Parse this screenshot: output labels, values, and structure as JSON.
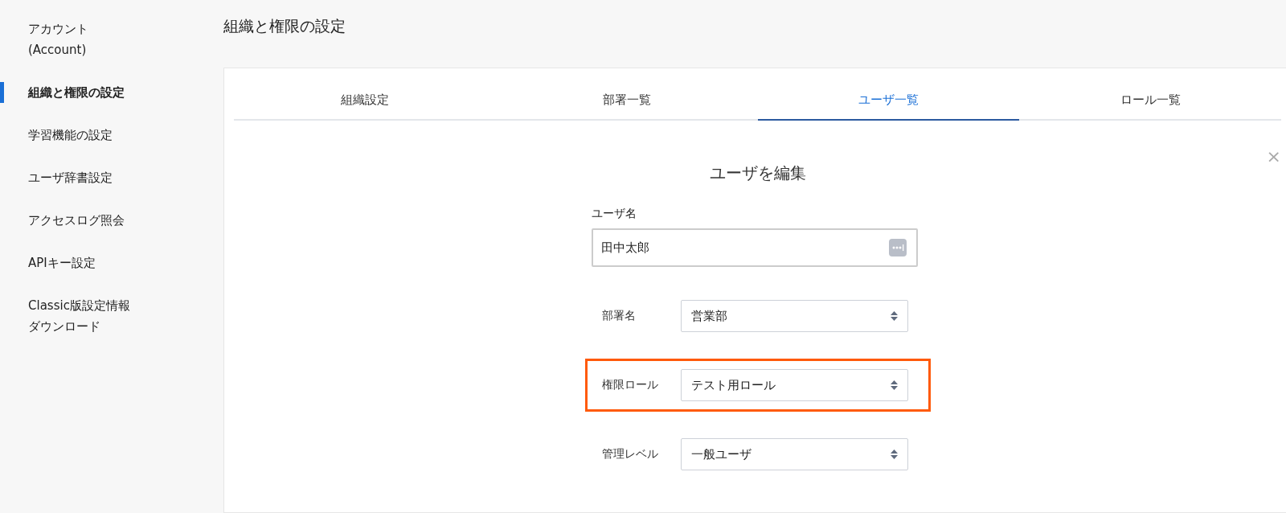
{
  "sidebar": {
    "items": [
      {
        "label": "アカウント (Account)",
        "selected": false
      },
      {
        "label": "組織と権限の設定",
        "selected": true
      },
      {
        "label": "学習機能の設定",
        "selected": false
      },
      {
        "label": "ユーザ辞書設定",
        "selected": false
      },
      {
        "label": "アクセスログ照会",
        "selected": false
      },
      {
        "label": "APIキー設定",
        "selected": false
      },
      {
        "label": "Classic版設定情報ダウンロード",
        "selected": false
      }
    ]
  },
  "page_title": "組織と権限の設定",
  "tabs": [
    {
      "label": "組織設定",
      "selected": false
    },
    {
      "label": "部署一覧",
      "selected": false
    },
    {
      "label": "ユーザ一覧",
      "selected": true
    },
    {
      "label": "ロール一覧",
      "selected": false
    }
  ],
  "dialog": {
    "title": "ユーザを編集",
    "close": "×",
    "fields": [
      {
        "kind": "text",
        "label": "ユーザ名",
        "value": "田中太郎"
      },
      {
        "kind": "select",
        "label": "部署名",
        "value": "営業部"
      },
      {
        "kind": "select",
        "label": "権限ロール",
        "value": "テスト用ロール",
        "highlighted": true
      },
      {
        "kind": "select",
        "label": "管理レベル",
        "value": "一般ユーザ"
      }
    ]
  }
}
